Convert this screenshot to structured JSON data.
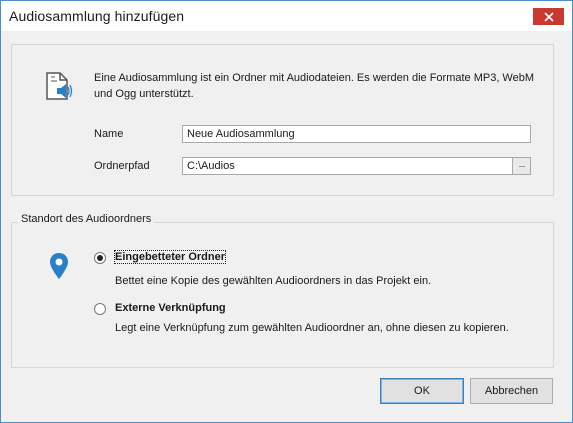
{
  "dialog": {
    "title": "Audiosammlung hinzufügen",
    "close_icon": "close-icon"
  },
  "intro": {
    "icon": "audio-document-icon",
    "text": "Eine Audiosammlung ist ein Ordner mit Audiodateien. Es werden die Formate MP3, WebM und Ogg unterstützt."
  },
  "fields": {
    "name_label": "Name",
    "name_value": "Neue Audiosammlung",
    "path_label": "Ordnerpfad",
    "path_value": "C:\\Audios",
    "browse_label": "···"
  },
  "location": {
    "group_title": "Standort des Audioordners",
    "icon": "map-pin-icon",
    "options": [
      {
        "label": "Eingebetteter Ordner",
        "description": "Bettet eine Kopie des gewählten Audioordners in das Projekt ein.",
        "selected": true
      },
      {
        "label": "Externe Verknüpfung",
        "description": "Legt eine Verknüpfung zum gewählten Audioordner an, ohne diesen zu kopieren.",
        "selected": false
      }
    ]
  },
  "buttons": {
    "ok": "OK",
    "cancel": "Abbrechen"
  },
  "colors": {
    "accent": "#4f8dc9",
    "close": "#c83a30",
    "pin": "#2b7fc7"
  }
}
